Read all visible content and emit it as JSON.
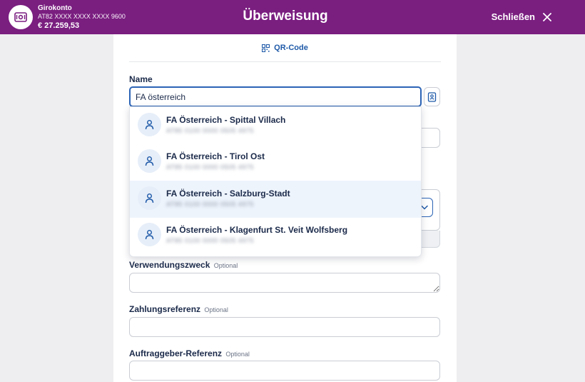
{
  "header": {
    "account_name": "Girokonto",
    "account_iban": "AT82 XXXX XXXX XXXX 9600",
    "account_balance": "€ 27.259,53",
    "title": "Überweisung",
    "close_label": "Schließen",
    "accent_color": "#7a1e80"
  },
  "qr": {
    "label": "QR-Code"
  },
  "name_field": {
    "label": "Name",
    "value": "FA österreich"
  },
  "suggestions": [
    {
      "name": "FA Österreich - Spittal Villach",
      "iban": "AT85 0100 0000 0505 4975"
    },
    {
      "name": "FA Österreich - Tirol Ost",
      "iban": "AT85 0100 0000 0505 4975"
    },
    {
      "name": "FA Österreich - Salzburg-Stadt",
      "iban": "AT85 0100 0000 0505 4975"
    },
    {
      "name": "FA Österreich - Klagenfurt St. Veit Wolfsberg",
      "iban": "AT85 0100 0000 0505 4975"
    }
  ],
  "purpose": {
    "label": "Verwendungszweck",
    "optional": "Optional"
  },
  "payment_reference": {
    "label": "Zahlungsreferenz",
    "optional": "Optional"
  },
  "payer_reference": {
    "label": "Auftraggeber-Referenz",
    "optional": "Optional"
  }
}
